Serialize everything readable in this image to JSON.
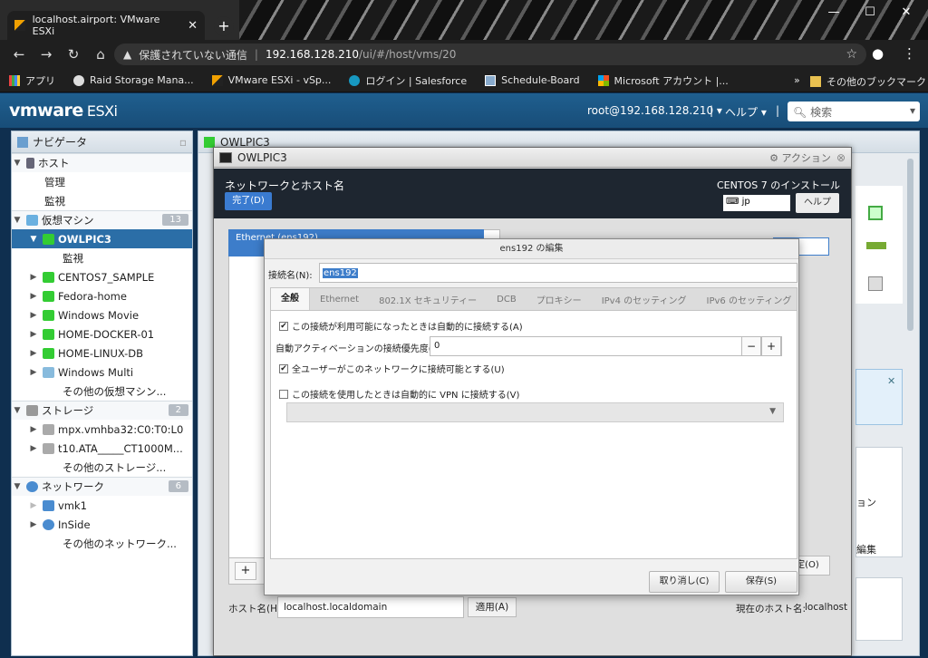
{
  "browser": {
    "tab_title": "localhost.airport: VMware ESXi",
    "tab_close": "✕",
    "new_tab": "+",
    "security_label": "保護されていない通信",
    "url_host": "192.168.128.210",
    "url_path": "/ui/#/host/vms/20",
    "bookmarks": [
      {
        "label": "アプリ"
      },
      {
        "label": "Raid Storage Mana..."
      },
      {
        "label": "VMware ESXi - vSp..."
      },
      {
        "label": "ログイン | Salesforce"
      },
      {
        "label": "Schedule-Board"
      },
      {
        "label": "Microsoft アカウント |..."
      }
    ],
    "other_bookmarks": "その他のブックマーク",
    "more": "»"
  },
  "esxi": {
    "logo_vm": "vmware",
    "logo_product": "ESXi",
    "user": "root@192.168.128.210 ▾",
    "help": "ヘルプ ▾",
    "search_placeholder": "検索",
    "sep": "|"
  },
  "navigator": {
    "title": "ナビゲータ",
    "host": "ホスト",
    "host_items": [
      "管理",
      "監視"
    ],
    "vms_label": "仮想マシン",
    "vms_count": "13",
    "vm_selected": "OWLPIC3",
    "vm_selected_sub": "監視",
    "vms": [
      "CENTOS7_SAMPLE",
      "Fedora-home",
      "Windows Movie",
      "HOME-DOCKER-01",
      "HOME-LINUX-DB",
      "Windows Multi"
    ],
    "vms_more": "その他の仮想マシン...",
    "storage_label": "ストレージ",
    "storage_count": "2",
    "storage": [
      "mpx.vmhba32:C0:T0:L0",
      "t10.ATA_____CT1000M..."
    ],
    "storage_more": "その他のストレージ...",
    "network_label": "ネットワーク",
    "network_count": "6",
    "network": [
      "vmk1",
      "InSide"
    ],
    "network_more": "その他のネットワーク..."
  },
  "main": {
    "title": "OWLPIC3"
  },
  "vm_console": {
    "title": "OWLPIC3",
    "actions": "アクション",
    "section_title": "ネットワークとホスト名",
    "done": "完了(D)",
    "install_title": "CENTOS 7 のインストール",
    "keyboard": "jp",
    "help_btn": "ヘルプ",
    "ethernet_label": "Ethernet (ens192)",
    "hostname_label": "ホスト名(H):",
    "hostname_value": "localhost.localdomain",
    "apply": "適用(A)",
    "current_host_label": "現在のホスト名:",
    "current_host_value": "localhost",
    "add": "+",
    "config_btn": "定(O)"
  },
  "dialog": {
    "title": "ens192 の編集",
    "conn_name_label": "接続名(N):",
    "conn_name_value": "ens192",
    "tabs": [
      "全般",
      "Ethernet",
      "802.1X セキュリティー",
      "DCB",
      "プロキシー",
      "IPv4 のセッティング",
      "IPv6 のセッティング"
    ],
    "auto_connect": "この接続が利用可能になったときは自動的に接続する(A)",
    "priority_label": "自動アクティベーションの接続優先度(P)",
    "priority_value": "0",
    "minus": "−",
    "plus": "+",
    "all_users": "全ユーザーがこのネットワークに接続可能とする(U)",
    "vpn": "この接続を使用したときは自動的に VPN に接続する(V)",
    "cancel": "取り消し(C)",
    "save": "保存(S)"
  },
  "right_panel": {
    "label1": "ョン",
    "label2": "編集"
  }
}
